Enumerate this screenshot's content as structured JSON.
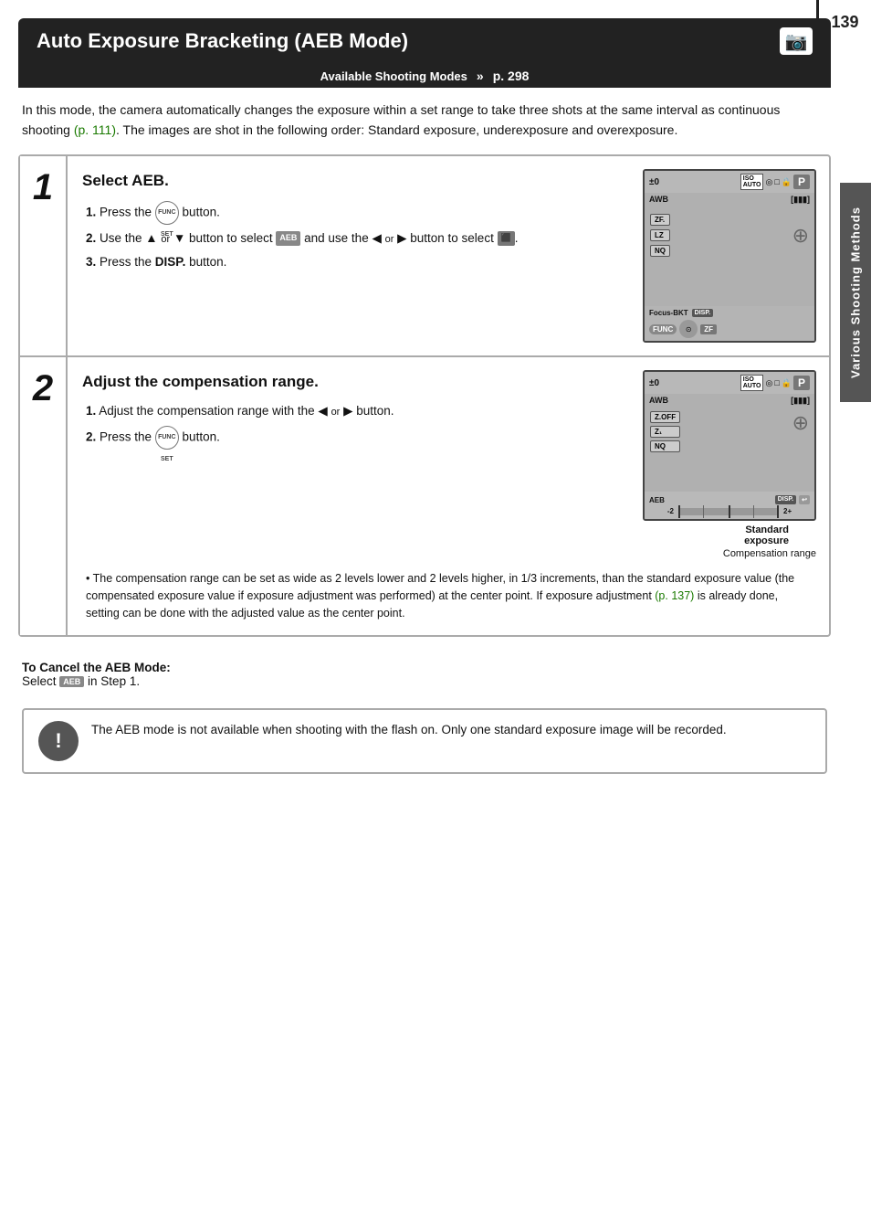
{
  "page": {
    "number": "139",
    "sidebar_label": "Various Shooting Methods"
  },
  "title": {
    "text": "Auto Exposure Bracketing (AEB Mode)",
    "camera_icon": "📷"
  },
  "modes_bar": {
    "label": "Available Shooting Modes",
    "arrow": "»",
    "page_ref": "p. 298"
  },
  "intro": {
    "text": "In this mode, the camera automatically changes the exposure within a set range to take three shots at the same interval as continuous shooting (p. 111). The images are shot in the following order: Standard exposure, underexposure and overexposure.",
    "link_text": "p. 111",
    "link_page": "111"
  },
  "step1": {
    "number": "1",
    "title": "Select AEB.",
    "items": [
      {
        "num": "1.",
        "text": "Press the  button."
      },
      {
        "num": "2.",
        "text": "Use the ▲ or ▼ button to select  and use the ◀ or ▶ button to select ."
      },
      {
        "num": "3.",
        "text": "Press the DISP. button."
      }
    ]
  },
  "step2": {
    "number": "2",
    "title": "Adjust the compensation range.",
    "items": [
      {
        "num": "1.",
        "text": "Adjust the compensation range with the ◀ or ▶ button."
      },
      {
        "num": "2.",
        "text": "Press the  button."
      }
    ],
    "note": "• The compensation range can be set as wide as 2 levels lower and 2 levels higher, in 1/3 increments, than the standard exposure value (the compensated exposure value if exposure adjustment was performed) at the center point. If exposure adjustment (p. 137) is already done, setting can be done with the adjusted value as the center point.",
    "link_text": "p. 137",
    "link_page": "137"
  },
  "cancel_section": {
    "heading": "To Cancel the AEB Mode:",
    "text": "Select  in Step 1."
  },
  "note_box": {
    "text": "The AEB mode is not available when shooting with the flash on. Only one standard exposure image will be recorded."
  }
}
